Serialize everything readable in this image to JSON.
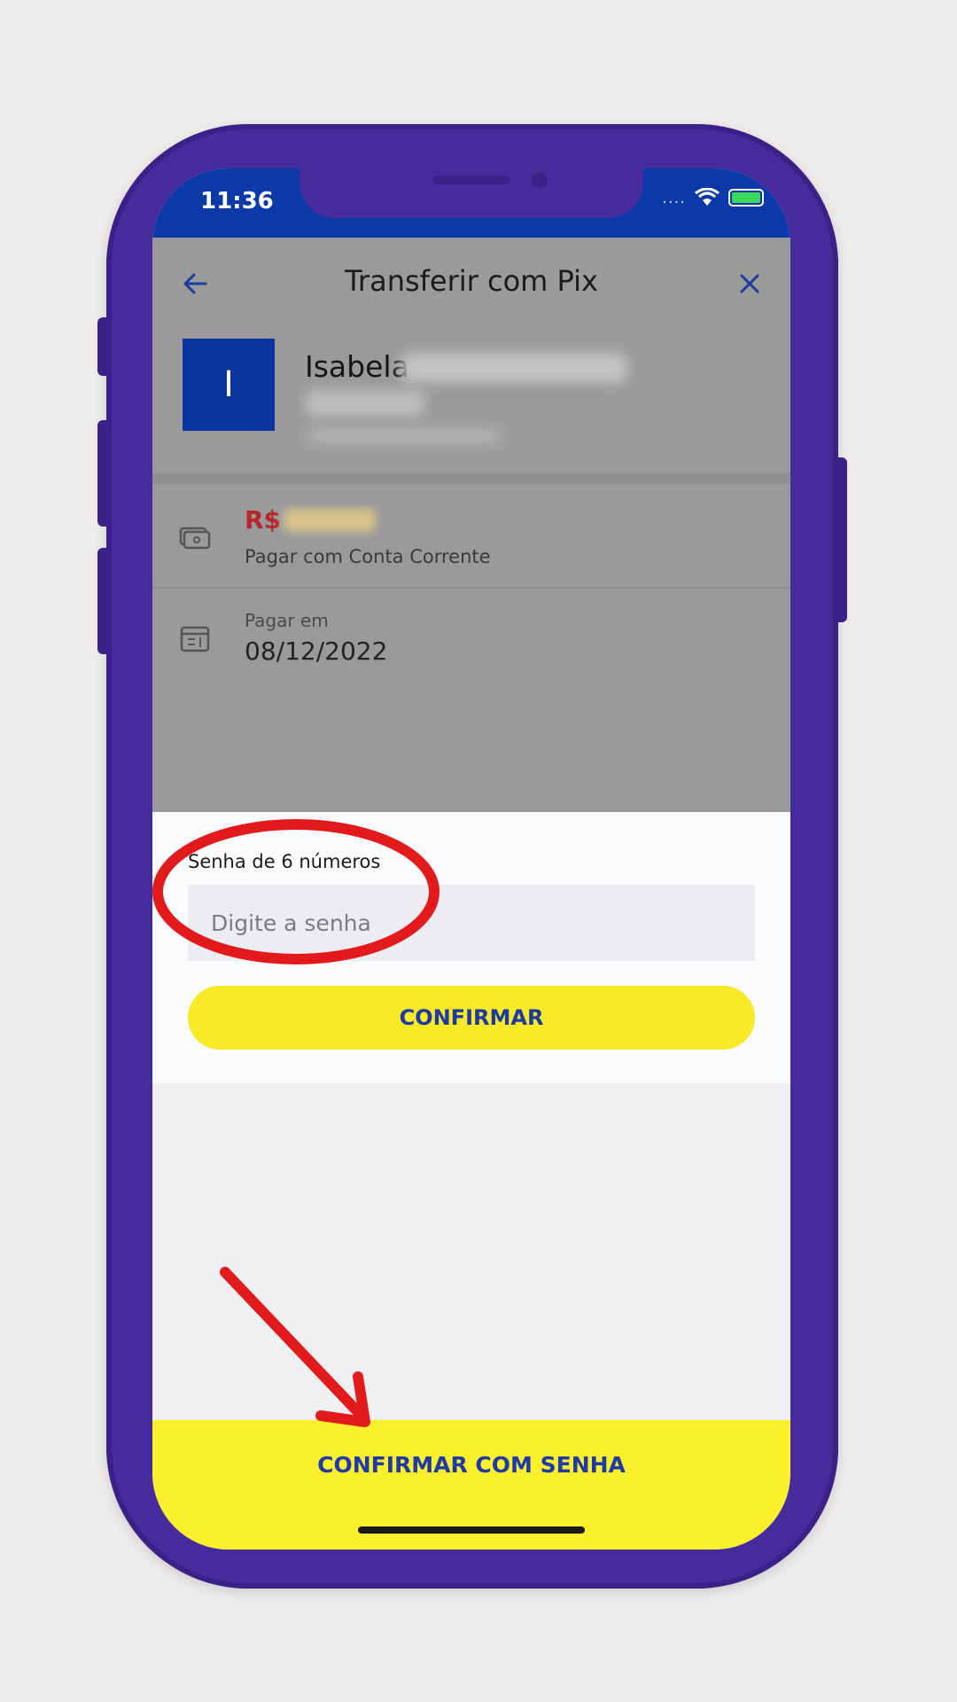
{
  "status_bar": {
    "time": "11:36",
    "signal_dots": "....",
    "icons": [
      "wifi-icon",
      "battery-icon"
    ],
    "battery_color": "#3ed65a"
  },
  "header": {
    "title": "Transferir com Pix",
    "back_icon": "arrow-left-icon",
    "close_icon": "close-icon",
    "color": "#0c39a8"
  },
  "recipient": {
    "avatar_initial": "I",
    "name_visible": "Isabela",
    "avatar_color": "#0c35a0"
  },
  "payment_details": {
    "amount_prefix": "R$",
    "payment_method": "Pagar com Conta Corrente",
    "date_caption": "Pagar em",
    "date_value": "08/12/2022",
    "amount_color": "#b4282d"
  },
  "password_sheet": {
    "label": "Senha de 6 números",
    "input_placeholder": "Digite a senha",
    "input_value": "",
    "confirm_label": "CONFIRMAR"
  },
  "bottom_action": {
    "label": "CONFIRMAR COM SENHA",
    "color": "#faf12c"
  },
  "annotations": {
    "highlight_color": "#e31a1c",
    "shapes": [
      "red-circle-highlight",
      "red-arrow"
    ]
  }
}
